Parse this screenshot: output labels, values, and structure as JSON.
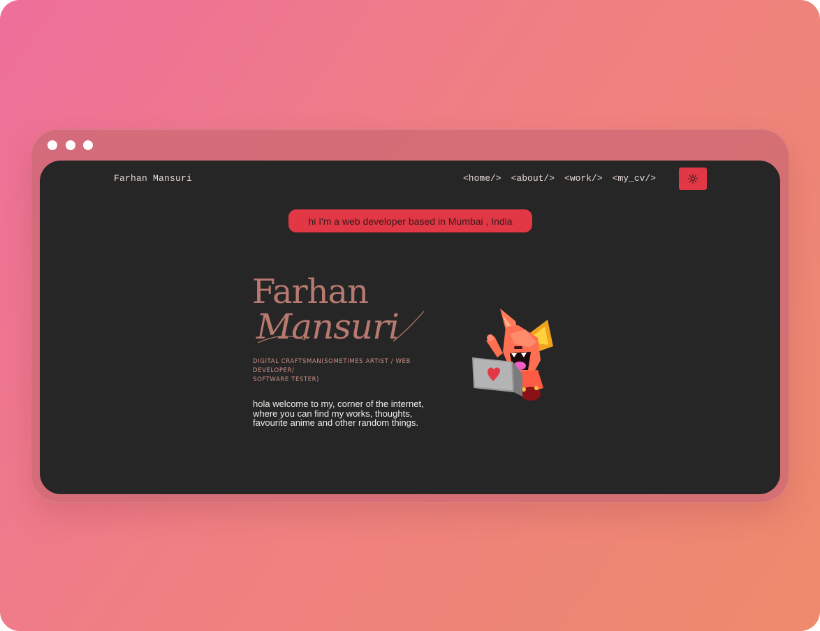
{
  "site": {
    "brand": "Farhan Mansuri",
    "nav": [
      {
        "label": "<home/>"
      },
      {
        "label": "<about/>"
      },
      {
        "label": "<work/>"
      },
      {
        "label": "<my_cv/>"
      }
    ],
    "theme_toggle_icon": "sun-icon"
  },
  "hero": {
    "tagline": "hi I'm a web developer based in Mumbai , India",
    "first_name": "Farhan",
    "last_name": "Mansuri",
    "role_line1": "DIGITAL CRAFTSMAN(SOMETIMES ARTIST / WEB DEVELOPER/",
    "role_line2": "SOFTWARE TESTER)",
    "intro": "hola welcome to my, corner of the internet, where you can find my works, thoughts, favourite anime and other random things.",
    "illustration": "fox-mascot-with-laptop"
  },
  "colors": {
    "background_start": "#ee6f9b",
    "background_end": "#ee8b6c",
    "screen": "#262626",
    "accent": "#e23744",
    "name_text": "#b87a70",
    "body_text": "#f0ece9"
  },
  "window_controls": [
    "dot",
    "dot",
    "dot"
  ]
}
